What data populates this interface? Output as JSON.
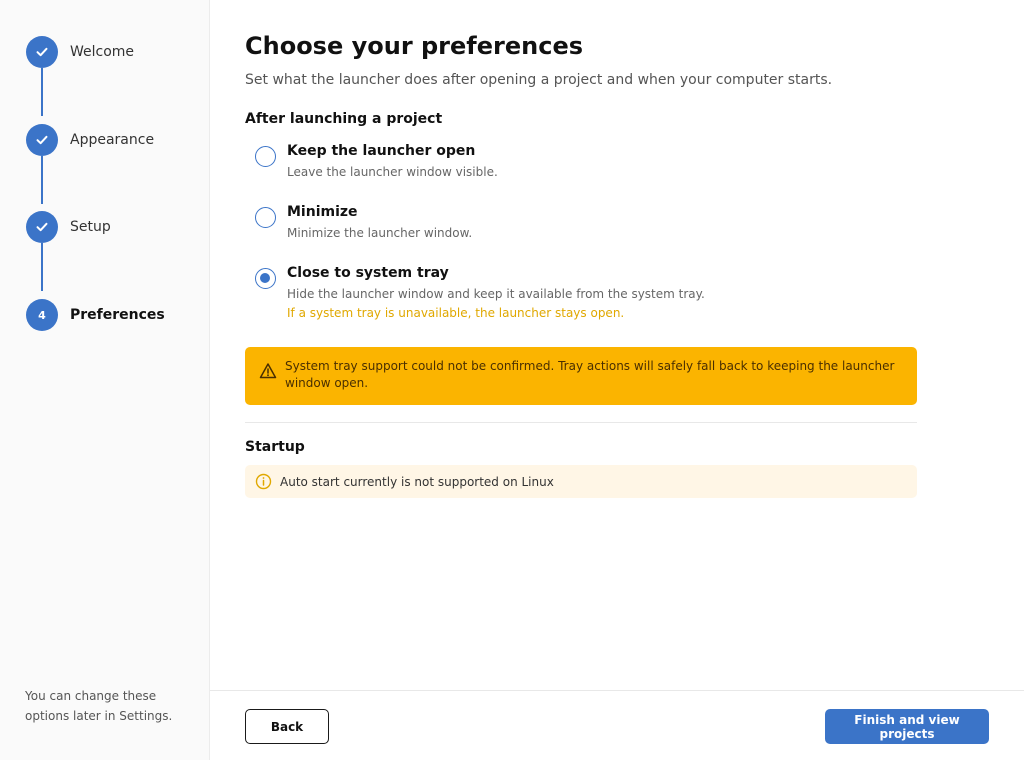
{
  "sidebar": {
    "steps": [
      {
        "label": "Welcome",
        "state": "done"
      },
      {
        "label": "Appearance",
        "state": "done"
      },
      {
        "label": "Setup",
        "state": "done"
      },
      {
        "label": "Preferences",
        "state": "current",
        "number": "4"
      }
    ],
    "note": "You can change these options later in Settings."
  },
  "main": {
    "title": "Choose your preferences",
    "subtitle": "Set what the launcher does after opening a project and when your computer starts.",
    "after_launch": {
      "heading": "After launching a project",
      "options": [
        {
          "title": "Keep the launcher open",
          "description": "Leave the launcher window visible.",
          "selected": false
        },
        {
          "title": "Minimize",
          "description": "Minimize the launcher window.",
          "selected": false
        },
        {
          "title": "Close to system tray",
          "description": "Hide the launcher window and keep it available from the system tray.",
          "note": "If a system tray is unavailable, the launcher stays open.",
          "selected": true
        }
      ]
    },
    "warning": "System tray support could not be confirmed. Tray actions will safely fall back to keeping the launcher window open.",
    "startup": {
      "heading": "Startup",
      "info": "Auto start currently is not supported on Linux"
    }
  },
  "footer": {
    "back_label": "Back",
    "finish_label": "Finish and view projects"
  },
  "colors": {
    "accent": "#3b74c8",
    "warning_bg": "#fbb400",
    "info_bg": "#fff6e6",
    "note_text": "#e0a800"
  },
  "icons": {
    "done_step": "check-icon",
    "warning": "warning-triangle-icon",
    "info": "info-circle-icon"
  }
}
